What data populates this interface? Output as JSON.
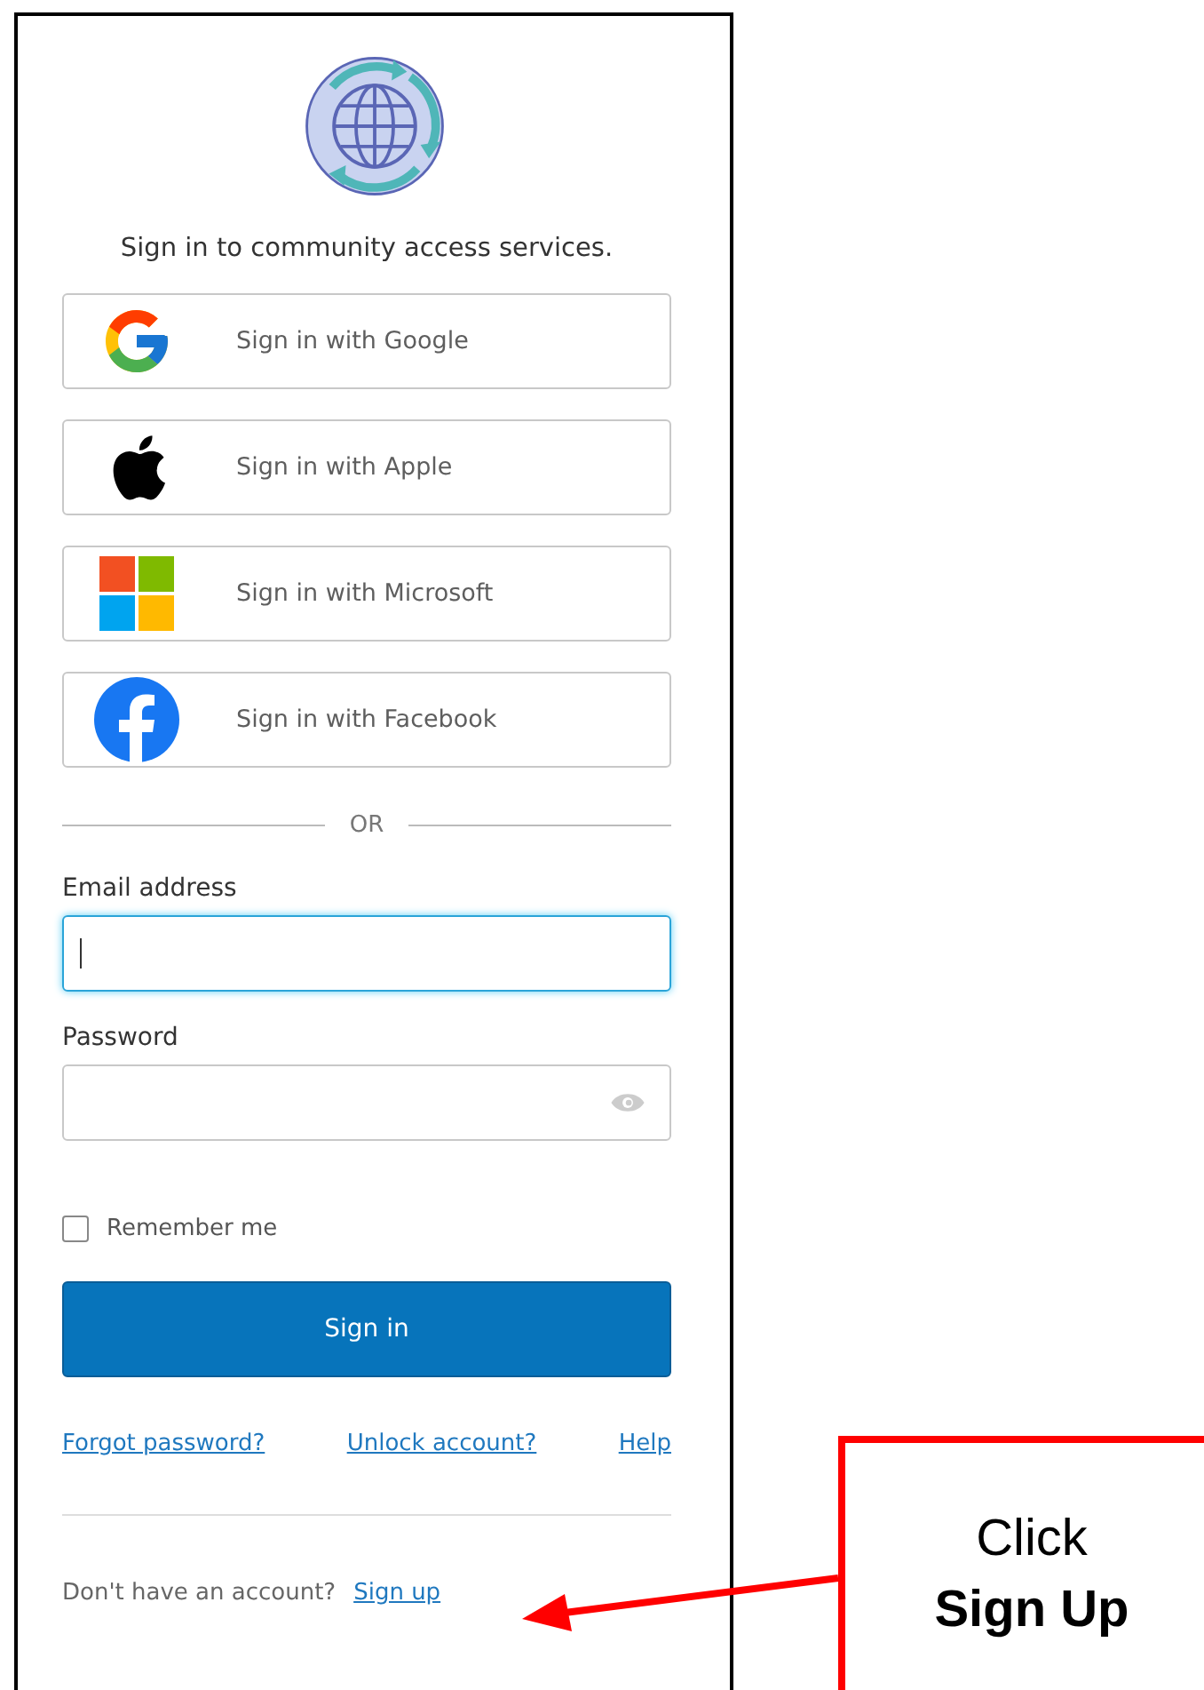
{
  "title": "Sign in to community access services.",
  "providers": [
    {
      "kind": "google",
      "label": "Sign in with Google"
    },
    {
      "kind": "apple",
      "label": "Sign in with Apple"
    },
    {
      "kind": "microsoft",
      "label": "Sign in with Microsoft"
    },
    {
      "kind": "facebook",
      "label": "Sign in with Facebook"
    }
  ],
  "separator": "OR",
  "email": {
    "label": "Email address",
    "focused": true
  },
  "password": {
    "label": "Password",
    "focused": false
  },
  "remember": {
    "label": "Remember me",
    "checked": false
  },
  "submit": "Sign in",
  "links": [
    "Forgot password?",
    "Unlock account?",
    "Help"
  ],
  "signup": {
    "text": "Don't have an account?",
    "link": "Sign up"
  },
  "callout": {
    "lines": [
      {
        "text": "Click",
        "bold": false
      },
      {
        "text": "Sign Up",
        "bold": true
      }
    ]
  }
}
